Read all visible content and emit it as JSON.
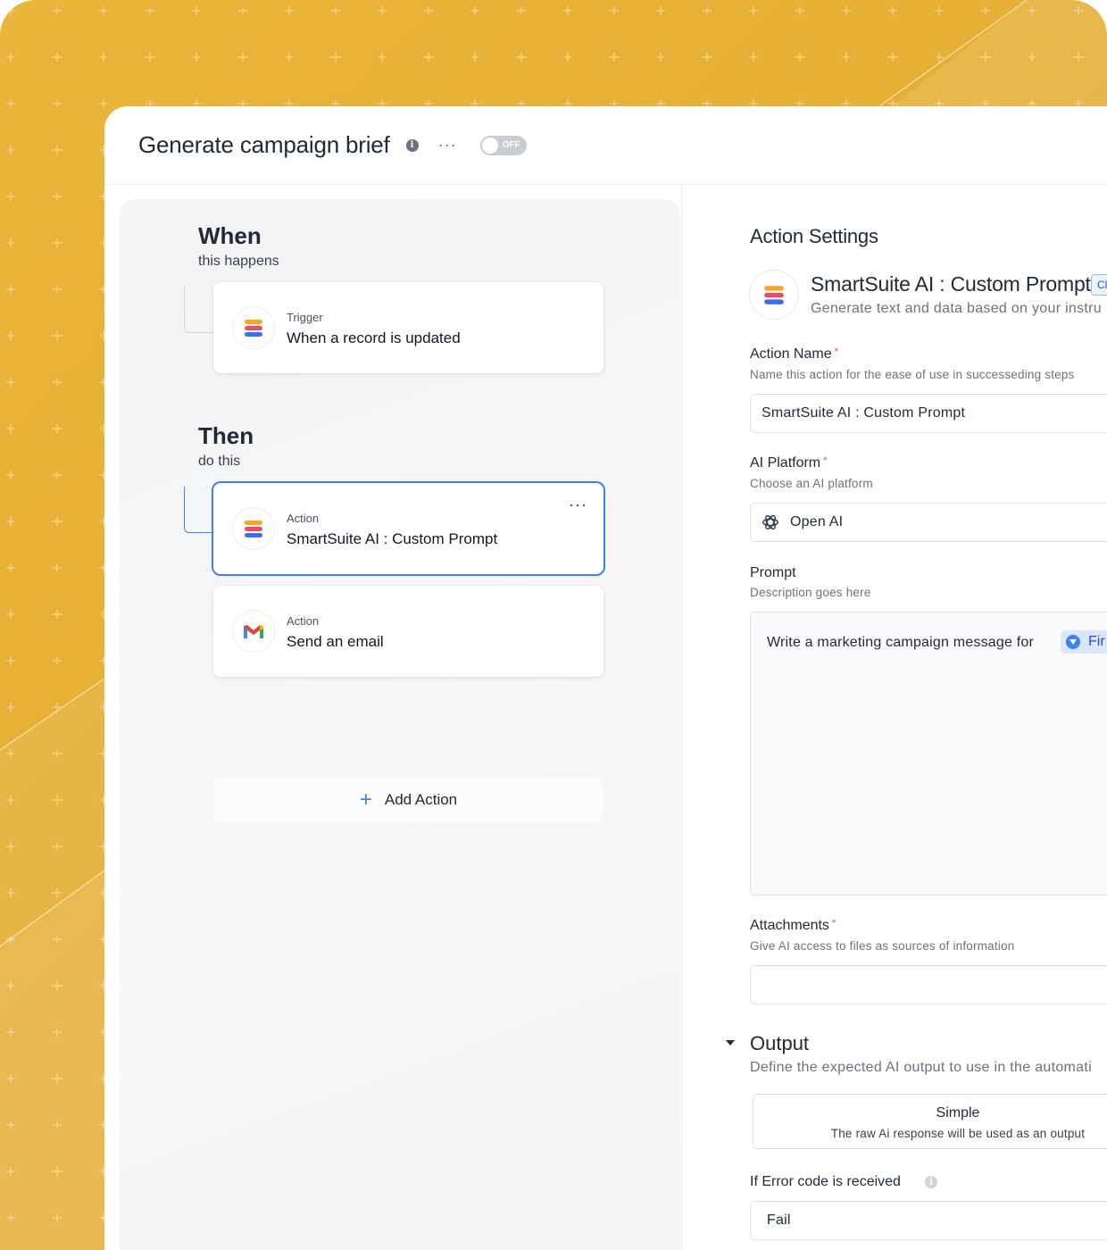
{
  "header": {
    "title": "Generate campaign brief",
    "info_icon": "info-icon",
    "more_label": "···",
    "toggle_label": "OFF"
  },
  "flow": {
    "when": {
      "heading": "When",
      "subheading": "this happens"
    },
    "then": {
      "heading": "Then",
      "subheading": "do this"
    },
    "trigger": {
      "kicker": "Trigger",
      "title": "When a record is updated",
      "icon": "smartsuite-logo-icon"
    },
    "actions": [
      {
        "kicker": "Action",
        "title": "SmartSuite AI : Custom Prompt",
        "icon": "smartsuite-logo-icon",
        "more": "···",
        "selected": true
      },
      {
        "kicker": "Action",
        "title": "Send an email",
        "icon": "gmail-icon",
        "selected": false
      }
    ],
    "add_action": {
      "icon": "plus-icon",
      "label": "Add Action"
    }
  },
  "settings": {
    "heading": "Action Settings",
    "app": {
      "title": "SmartSuite AI : Custom Prompt",
      "badge": "Cl",
      "description": "Generate text and data based on your instru"
    },
    "action_name": {
      "label": "Action Name",
      "required": "*",
      "description": "Name this action for the ease of use in successeding steps",
      "value": "SmartSuite AI : Custom Prompt"
    },
    "ai_platform": {
      "label": "AI Platform",
      "required": "*",
      "description": "Choose an AI platform",
      "value": "Open AI",
      "icon": "openai-icon"
    },
    "prompt": {
      "label": "Prompt",
      "description": "Description goes here",
      "text": "Write a marketing campaign message for",
      "token": "Fir"
    },
    "attachments": {
      "label": "Attachments",
      "required": "*",
      "description": "Give AI access to files as sources of information",
      "value": ""
    },
    "output": {
      "heading": "Output",
      "description": "Define the expected AI output to use in the automati",
      "option_title": "Simple",
      "option_description": "The raw Ai response will be used as an output"
    },
    "error": {
      "label": "If Error code is received",
      "value": "Fail"
    }
  },
  "colors": {
    "background": "#e6b038",
    "accent": "#3b82f6",
    "required": "#ef4444"
  }
}
